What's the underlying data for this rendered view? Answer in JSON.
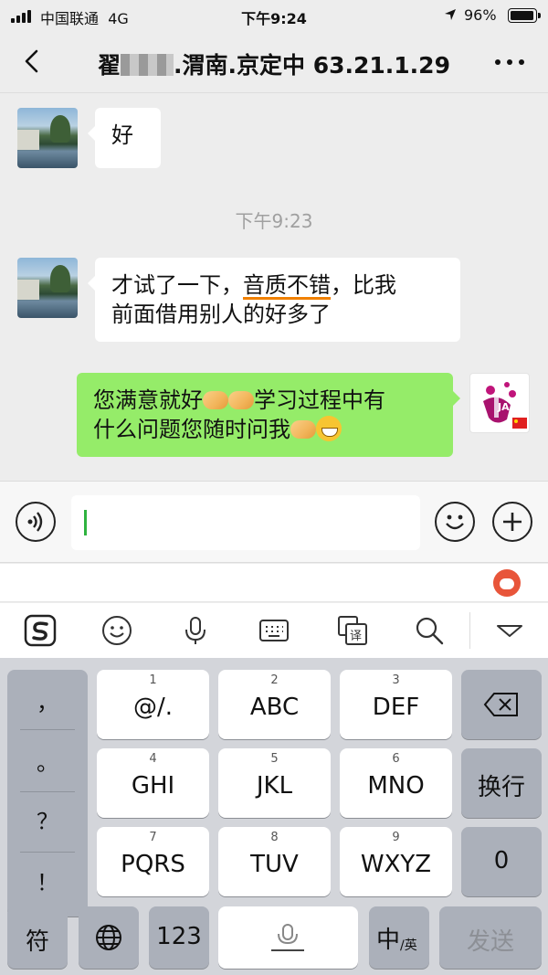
{
  "status_bar": {
    "carrier": "中国联通",
    "network": "4G",
    "time": "下午9:24",
    "battery": "96%",
    "battery_level": 0.96
  },
  "nav": {
    "title_prefix": "翟",
    "title_suffix": ".渭南.京定中 63.21.1.29"
  },
  "messages": [
    {
      "side": "left",
      "text": "好"
    },
    {
      "type": "timestamp",
      "text": "下午9:23"
    },
    {
      "side": "left",
      "line1_pre": "才试了一下，",
      "line1_underlined": "音质不错",
      "line1_post": "，比我",
      "line2": "前面借用别人的好多了"
    },
    {
      "side": "right",
      "part1": "您满意就好",
      "part2": "学习过程中有",
      "part3": "什么问题您随时问我"
    }
  ],
  "avatar_right_text": "JAZZ",
  "input": {
    "value": ""
  },
  "keyboard": {
    "punctuation": [
      "，",
      "。",
      "？",
      "！"
    ],
    "rows": [
      [
        {
          "num": "1",
          "label": "@/."
        },
        {
          "num": "2",
          "label": "ABC"
        },
        {
          "num": "3",
          "label": "DEF"
        }
      ],
      [
        {
          "num": "4",
          "label": "GHI"
        },
        {
          "num": "5",
          "label": "JKL"
        },
        {
          "num": "6",
          "label": "MNO"
        }
      ],
      [
        {
          "num": "7",
          "label": "PQRS"
        },
        {
          "num": "8",
          "label": "TUV"
        },
        {
          "num": "9",
          "label": "WXYZ"
        }
      ]
    ],
    "return_label": "换行",
    "zero_label": "0",
    "symbol_label": "符",
    "num_label": "123",
    "lang_main": "中",
    "lang_sub": "/英",
    "send_label": "发送"
  },
  "icons": {
    "back": "chevron-left-icon",
    "more": "more-dots-icon",
    "voice": "voice-icon",
    "emoji": "emoji-icon",
    "plus": "plus-icon",
    "sogou": "sogou-logo-icon",
    "keyboard_emoji": "keyboard-emoji-icon",
    "mic": "microphone-icon",
    "keyboard": "keyboard-icon",
    "translate": "translate-icon",
    "search": "search-icon",
    "collapse": "collapse-icon",
    "globe": "globe-icon",
    "delete": "delete-icon"
  },
  "colors": {
    "sent_bubble": "#95ec69",
    "caret": "#2fb33f",
    "underline": "#f08000"
  }
}
